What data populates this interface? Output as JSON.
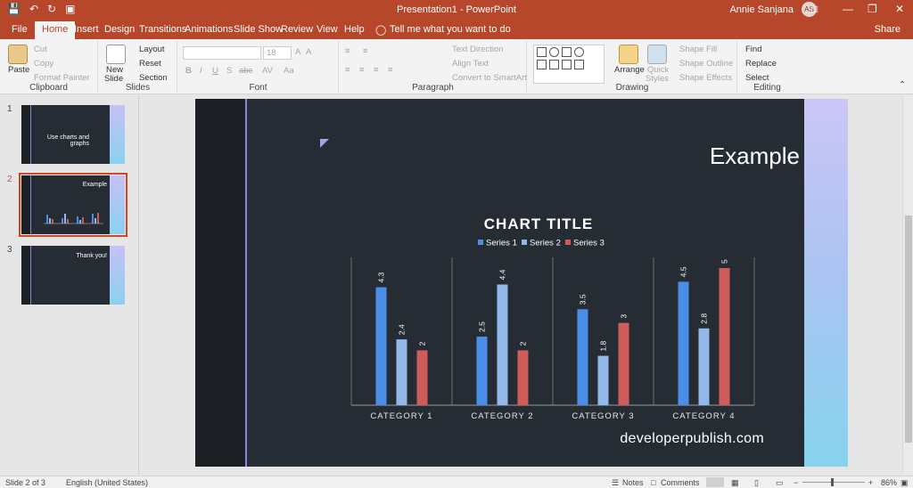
{
  "titlebar": {
    "qat": {
      "save": "💾",
      "undo": "↶",
      "redo": "↻",
      "present": "▣"
    },
    "title": "Presentation1  -  PowerPoint",
    "user": "Annie Sanjana",
    "avatar": "AS",
    "buttons": {
      "ribbon_options": "□",
      "minimize": "—",
      "restore": "❐",
      "close": "✕"
    }
  },
  "tabs": [
    "File",
    "Home",
    "Insert",
    "Design",
    "Transitions",
    "Animations",
    "Slide Show",
    "Review",
    "View",
    "Help"
  ],
  "tell_me": "Tell me what you want to do",
  "share": "Share",
  "ribbon": {
    "clipboard": {
      "label": "Clipboard",
      "paste": "Paste",
      "cut": "Cut",
      "copy": "Copy",
      "format_painter": "Format Painter"
    },
    "slides": {
      "label": "Slides",
      "new_slide": "New",
      "new_slide2": "Slide",
      "layout": "Layout",
      "reset": "Reset",
      "section": "Section"
    },
    "font": {
      "label": "Font",
      "size": "18",
      "bold": "B",
      "italic": "I",
      "underline": "U",
      "shadow": "S",
      "strike": "abc",
      "spacing": "AV",
      "case": "Aa",
      "grow": "A",
      "shrink": "A"
    },
    "paragraph": {
      "label": "Paragraph",
      "text_direction": "Text Direction",
      "align_text": "Align Text",
      "smartart": "Convert to SmartArt"
    },
    "drawing": {
      "label": "Drawing",
      "arrange": "Arrange",
      "quick_styles": "Quick",
      "quick_styles2": "Styles",
      "shape_fill": "Shape Fill",
      "shape_outline": "Shape Outline",
      "shape_effects": "Shape Effects"
    },
    "editing": {
      "label": "Editing",
      "find": "Find",
      "replace": "Replace",
      "select": "Select"
    }
  },
  "thumbnails": [
    {
      "num": "1",
      "text": "Use charts and graphs"
    },
    {
      "num": "2",
      "text": "Example"
    },
    {
      "num": "3",
      "text": "Thank you!"
    }
  ],
  "slide": {
    "title": "Example",
    "footer": "developerpublish.com"
  },
  "chart_data": {
    "type": "bar",
    "title": "CHART TITLE",
    "categories": [
      "CATEGORY 1",
      "CATEGORY 2",
      "CATEGORY 3",
      "CATEGORY 4"
    ],
    "series": [
      {
        "name": "Series 1",
        "values": [
          4.3,
          2.5,
          3.5,
          4.5
        ],
        "color": "#4a8ee8"
      },
      {
        "name": "Series 2",
        "values": [
          2.4,
          4.4,
          1.8,
          2.8
        ],
        "color": "#93b8ea"
      },
      {
        "name": "Series 3",
        "values": [
          2,
          2,
          3,
          5
        ],
        "color": "#cf5b5b"
      }
    ],
    "ylim": [
      0,
      5
    ],
    "grid": false,
    "legend": "top",
    "data_labels": true
  },
  "status": {
    "slide": "Slide 2 of 3",
    "language": "English (United States)",
    "notes": "Notes",
    "comments": "Comments",
    "zoom": "86%"
  }
}
